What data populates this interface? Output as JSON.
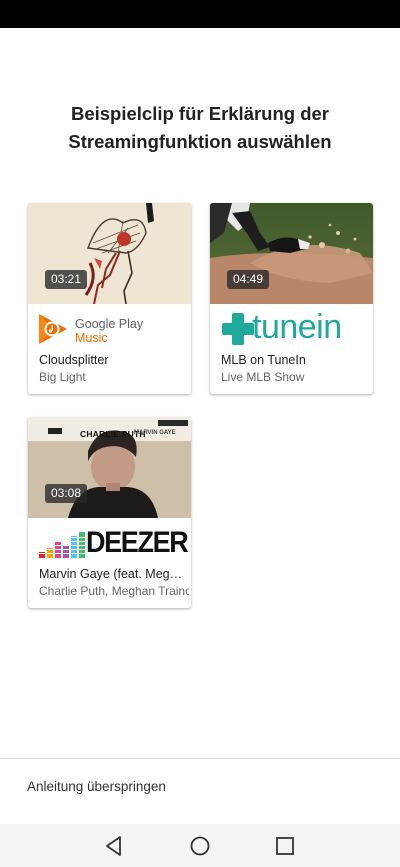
{
  "heading": {
    "line1": "Beispielclip für Erklärung der",
    "line2": "Streamingfunktion auswählen"
  },
  "clips": [
    {
      "duration": "03:21",
      "service": "Google Play Music",
      "service_name_line1": "Google Play",
      "service_name_line2": "Music",
      "title": "Cloudsplitter",
      "artist": "Big Light"
    },
    {
      "duration": "04:49",
      "service": "tunein",
      "title": "MLB on TuneIn",
      "artist": "Live MLB Show"
    },
    {
      "duration": "03:08",
      "service": "DEEZER",
      "title": "Marvin Gaye (feat. Megha…",
      "artist": "Charlie Puth, Meghan Trainor",
      "cover_artist": "CHARLIE PUTH",
      "cover_track": "MARVIN GAYE"
    }
  ],
  "skip_label": "Anleitung überspringen",
  "colors": {
    "google_orange": "#ef6c00",
    "tunein_teal": "#1fa99b",
    "deezer_black": "#111111"
  },
  "nav_icons": [
    "back-icon",
    "home-icon",
    "recents-icon"
  ]
}
